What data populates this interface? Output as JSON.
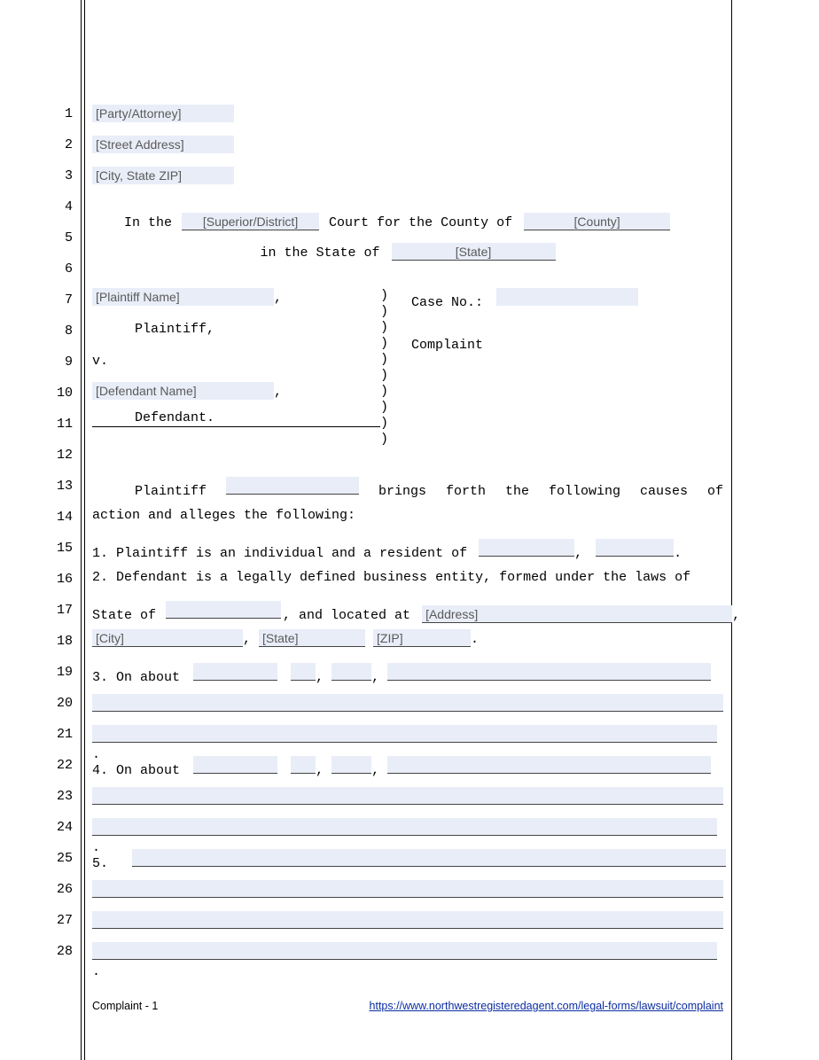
{
  "line_numbers": [
    1,
    2,
    3,
    4,
    5,
    6,
    7,
    8,
    9,
    10,
    11,
    12,
    13,
    14,
    15,
    16,
    17,
    18,
    19,
    20,
    21,
    22,
    23,
    24,
    25,
    26,
    27,
    28
  ],
  "line_tops": [
    120,
    155,
    190,
    225,
    260,
    295,
    330,
    365,
    400,
    435,
    470,
    505,
    540,
    575,
    610,
    645,
    680,
    715,
    750,
    785,
    820,
    855,
    890,
    925,
    960,
    995,
    1030,
    1065
  ],
  "attorney_block": {
    "party": "[Party/Attorney]",
    "street": "[Street Address]",
    "csz": "[City, State ZIP]"
  },
  "court_line": {
    "prefix": "In the",
    "court_type_placeholder": "[Superior/District]",
    "mid": "Court for the County of",
    "county_placeholder": "[County]",
    "line2_prefix": "in the State of",
    "state_placeholder": "[State]"
  },
  "caption": {
    "plaintiff_name_placeholder": "[Plaintiff Name]",
    "plaintiff_comma": ",",
    "plaintiff_label": "Plaintiff,",
    "vs": "v.",
    "defendant_name_placeholder": "[Defendant Name]",
    "defendant_comma": ",",
    "defendant_label": "Defendant.",
    "case_no_label": "Case No.:",
    "doc_title": "Complaint"
  },
  "body": {
    "intro_a": "Plaintiff",
    "intro_b": "brings  forth  the  following  causes  of",
    "intro_c": "action and alleges the following:",
    "p1_prefix": "1.   Plaintiff is an individual and a resident of",
    "p1_comma": ",",
    "p1_period": ".",
    "p2_text": "2.   Defendant is a legally defined business entity, formed under the laws of",
    "p2b_prefix": "State of",
    "p2b_mid": ", and located at",
    "address_placeholder": "[Address]",
    "city_placeholder": "[City]",
    "state_placeholder": "[State]",
    "zip_placeholder": "[ZIP]",
    "p3_prefix": "3.   On about",
    "p4_prefix": "4.   On about",
    "p5_prefix": "5."
  },
  "footer": {
    "left": "Complaint - 1",
    "url": "https://www.northwestregisteredagent.com/legal-forms/lawsuit/complaint"
  }
}
